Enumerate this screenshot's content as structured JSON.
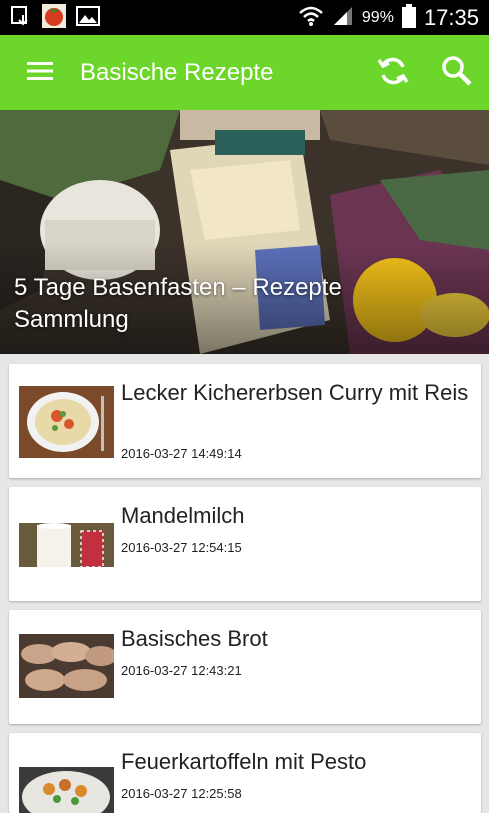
{
  "status_bar": {
    "battery_percent": "99%",
    "time": "17:35",
    "icons": [
      "download-icon",
      "tomato-app-icon",
      "image-icon",
      "wifi-icon",
      "signal-icon",
      "battery-icon"
    ]
  },
  "app_bar": {
    "title": "Basische Rezepte",
    "color": "#6dd62a",
    "menu_icon": "hamburger-menu-icon",
    "refresh_icon": "refresh-icon",
    "search_icon": "search-icon"
  },
  "featured": {
    "title": "5 Tage Basenfasten – Rezepte Sammlung"
  },
  "recipes": [
    {
      "title": "Lecker Kichererbsen Curry mit Reis",
      "date": "2016-03-27 14:49:14"
    },
    {
      "title": "Mandelmilch",
      "date": "2016-03-27 12:54:15"
    },
    {
      "title": "Basisches Brot",
      "date": "2016-03-27 12:43:21"
    },
    {
      "title": "Feuerkartoffeln mit Pesto",
      "date": "2016-03-27 12:25:58"
    }
  ]
}
